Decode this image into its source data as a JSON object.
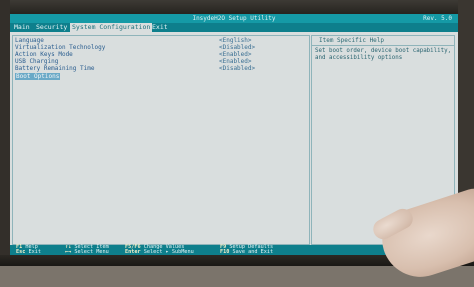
{
  "bios": {
    "title": "InsydeH2O Setup Utility",
    "revision": "Rev. 5.0",
    "tabs": [
      "Main",
      "Security",
      "System Configuration",
      "Exit"
    ],
    "active_tab": "System Configuration",
    "settings": [
      {
        "label": "Language",
        "value": "<English>"
      },
      {
        "label": "Virtualization Technology",
        "value": "<Disabled>"
      },
      {
        "label": "Action Keys Mode",
        "value": "<Enabled>"
      },
      {
        "label": "USB Charging",
        "value": "<Enabled>"
      },
      {
        "label": "Battery Remaining Time",
        "value": "<Disabled>"
      },
      {
        "label": "Boot Options",
        "value": ""
      }
    ],
    "selected_item": "Boot Options",
    "help_title": "Item Specific Help",
    "help_text": "Set boot order, device boot capability, and accessibility options",
    "footer": [
      {
        "key": "F1",
        "action": "Help"
      },
      {
        "key": "Esc",
        "action": "Exit"
      },
      {
        "key": "↑↓",
        "action": "Select Item"
      },
      {
        "key": "←→",
        "action": "Select Menu"
      },
      {
        "key": "F5/F6",
        "action": "Change Values"
      },
      {
        "key": "Enter",
        "action": "Select ▸ SubMenu"
      },
      {
        "key": "F9",
        "action": "Setup Defaults"
      },
      {
        "key": "F10",
        "action": "Save and Exit"
      }
    ]
  },
  "colors": {
    "title_bar": "#159aa6",
    "menu_bar": "#0e7f8c",
    "background": "#d9dede",
    "text_blue": "#2a5d8f",
    "selected": "#6aa9c7"
  }
}
